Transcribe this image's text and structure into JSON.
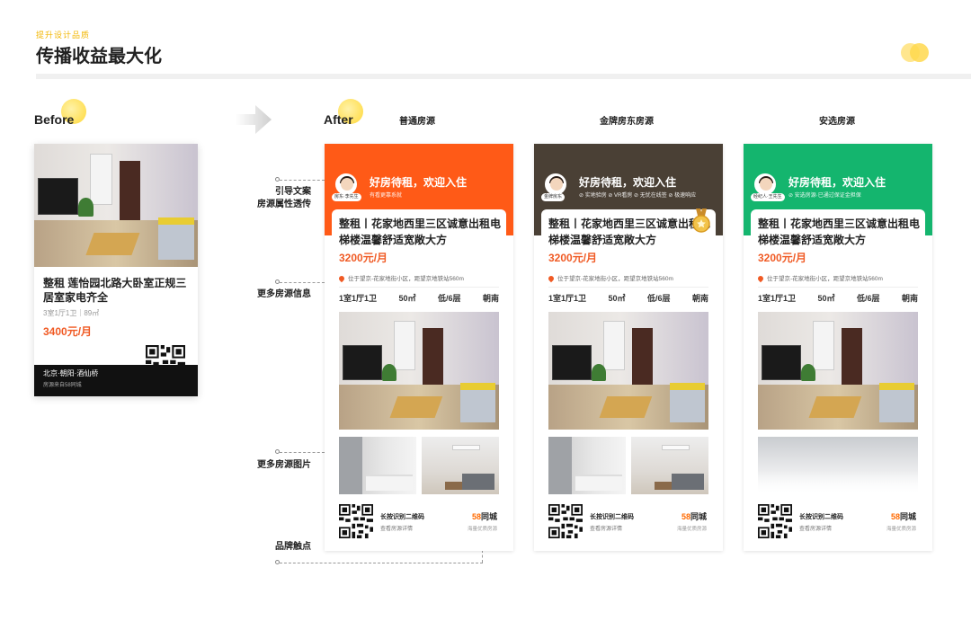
{
  "header": {
    "subtitle": "提升设计品质",
    "title": "传播收益最大化"
  },
  "sections": {
    "before_label": "Before",
    "after_label": "After"
  },
  "columns": [
    "普通房源",
    "金牌房东房源",
    "安选房源"
  ],
  "annotations": {
    "guide_copy": "引导文案",
    "attr_reveal": "房源属性透传",
    "more_info": "更多房源信息",
    "more_photos": "更多房源图片",
    "brand_touch": "品牌触点"
  },
  "before_card": {
    "title": "整租 莲怡园北路大卧室正规三居室家电齐全",
    "meta": "3室1厅1卫｜89㎡",
    "price": "3400元/月",
    "foot_location": "北京·朝阳·酒仙桥",
    "foot_source": "房源来自58同城"
  },
  "cards": [
    {
      "header_title": "好房待租，欢迎入住",
      "header_sub": "有看更靠系就",
      "avatar_tag": "房东·李先生",
      "listing_title": "整租丨花家地西里三区诚意出租电梯楼温馨舒适宽敞大方",
      "price": "3200元/月",
      "location": "位于望京-花家地街小区，距望京地铁站560m",
      "attrs": [
        "1室1厅1卫",
        "50㎡",
        "低/6层",
        "朝南"
      ],
      "qr_text": "长按识别二维码",
      "qr_sub": "查看房源详情",
      "brand": "同城",
      "brand_num": "58",
      "brand_sub": "海量优质房源",
      "header_color": "#ff5a17"
    },
    {
      "header_title": "好房待租，欢迎入住",
      "header_sub": "⊘ 实地验房 ⊘ VR看房 ⊘ 无忧在线签 ⊘ 极速响应",
      "avatar_tag": "金牌房东",
      "listing_title": "整租丨花家地西里三区诚意出租电梯楼温馨舒适宽敞大方",
      "price": "3200元/月",
      "location": "位于望京-花家地街小区，距望京地铁站560m",
      "attrs": [
        "1室1厅1卫",
        "50㎡",
        "低/6层",
        "朝南"
      ],
      "qr_text": "长按识别二维码",
      "qr_sub": "查看房源详情",
      "brand": "同城",
      "brand_num": "58",
      "brand_sub": "海量优质房源",
      "header_color": "#4a4035"
    },
    {
      "header_title": "好房待租，欢迎入住",
      "header_sub": "⊘ 安选房源·已通过保证金担保",
      "avatar_tag": "经纪人·王先生",
      "listing_title": "整租丨花家地西里三区诚意出租电梯楼温馨舒适宽敞大方",
      "price": "3200元/月",
      "location": "位于望京-花家地街小区，距望京地铁站560m",
      "attrs": [
        "1室1厅1卫",
        "50㎡",
        "低/6层",
        "朝南"
      ],
      "qr_text": "长按识别二维码",
      "qr_sub": "查看房源详情",
      "brand": "同城",
      "brand_num": "58",
      "brand_sub": "海量优质房源",
      "header_color": "#14b56e"
    }
  ],
  "icons": [
    "arrow-right-icon",
    "location-pin-icon",
    "qr-code-icon",
    "medal-icon",
    "avatar-icon"
  ]
}
